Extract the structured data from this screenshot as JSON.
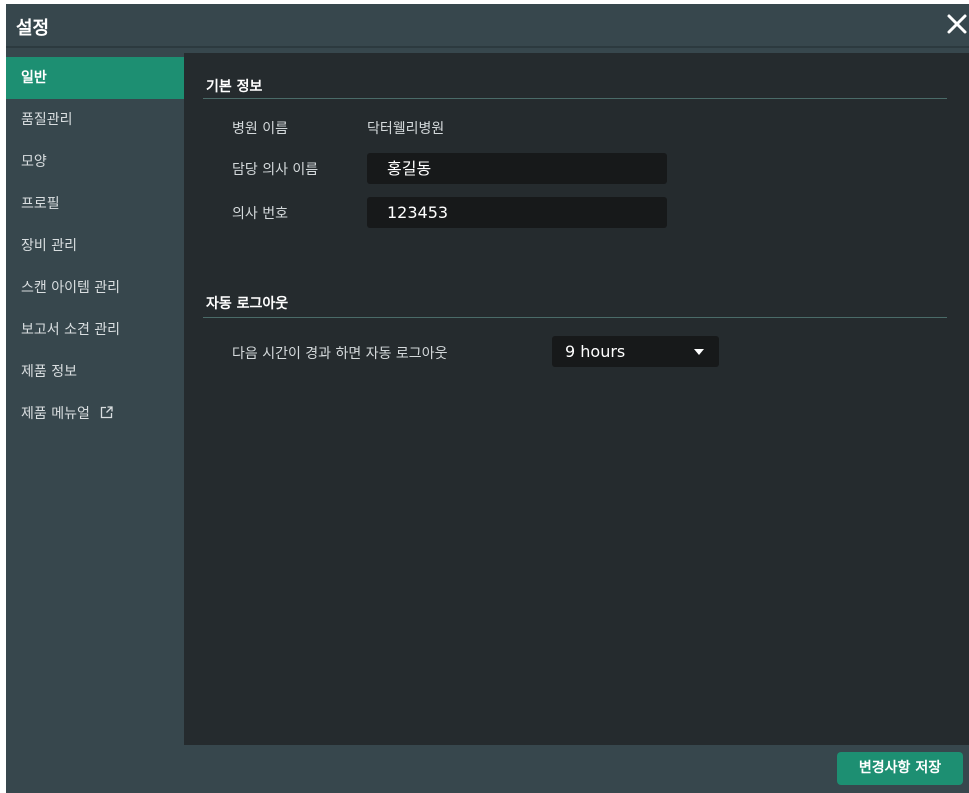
{
  "dialog": {
    "title": "설정",
    "close_icon": "close-icon"
  },
  "sidebar": {
    "items": [
      {
        "label": "일반",
        "active": true
      },
      {
        "label": "품질관리"
      },
      {
        "label": "모양"
      },
      {
        "label": "프로필"
      },
      {
        "label": "장비 관리"
      },
      {
        "label": "스캔 아이템 관리"
      },
      {
        "label": "보고서 소견 관리"
      },
      {
        "label": "제품 정보"
      },
      {
        "label": "제품 메뉴얼",
        "icon": "external-link-icon"
      }
    ]
  },
  "basic_info": {
    "title": "기본 정보",
    "hospital_name_label": "병원 이름",
    "hospital_name_value": "닥터웰리병원",
    "doctor_name_label": "담당 의사 이름",
    "doctor_name_value": "홍길동",
    "doctor_number_label": "의사 번호",
    "doctor_number_value": "123453"
  },
  "auto_logout": {
    "title": "자동 로그아웃",
    "label": "다음 시간이 경과 하면 자동 로그아웃",
    "selected": "9 hours"
  },
  "footer": {
    "save_label": "변경사항 저장"
  },
  "colors": {
    "accent": "#1d8f72",
    "dialog_bg": "#37474d",
    "content_bg": "#252b2e",
    "field_bg": "#17191a"
  }
}
